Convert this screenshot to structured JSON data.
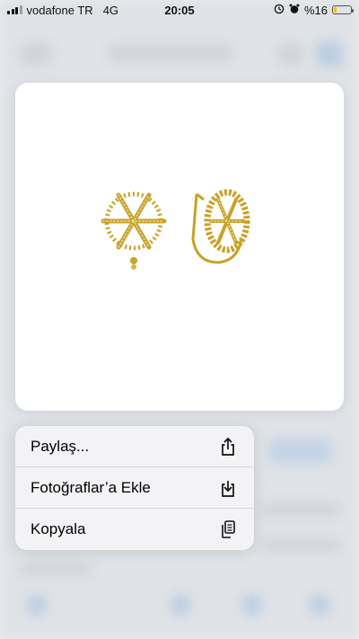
{
  "status_bar": {
    "carrier": "vodafone TR",
    "network": "4G",
    "time": "20:05",
    "battery_percent_text": "%16",
    "battery_level": 0.16,
    "battery_color": "#f2c200",
    "icons": [
      "signal-icon",
      "location-icon",
      "alarm-icon",
      "battery-icon"
    ]
  },
  "preview": {
    "image_subject": "gold snowflake earrings",
    "image_semantic": "product-image",
    "accent_gold": "#c9a227"
  },
  "context_menu": {
    "items": [
      {
        "label": "Paylaş...",
        "icon": "share-icon"
      },
      {
        "label": "Fotoğraflar’a Ekle",
        "icon": "save-to-photos-icon"
      },
      {
        "label": "Kopyala",
        "icon": "copy-icon"
      }
    ]
  }
}
